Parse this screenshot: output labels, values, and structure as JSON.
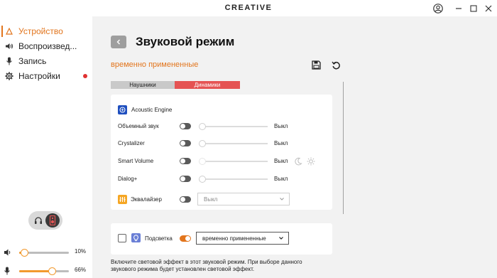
{
  "titlebar": {
    "brand": "CREATIVE",
    "icons": [
      "user-icon",
      "minimize-icon",
      "maximize-icon",
      "close-icon"
    ]
  },
  "sidebar": {
    "items": [
      {
        "label": "Устройство",
        "icon": "device-icon",
        "active": true
      },
      {
        "label": "Воспроизвед...",
        "icon": "playback-icon",
        "active": false
      },
      {
        "label": "Запись",
        "icon": "microphone-icon",
        "active": false
      },
      {
        "label": "Настройки",
        "icon": "gear-icon",
        "active": false,
        "badge": true
      }
    ],
    "mode_toggle": {
      "options": [
        "headphones-icon",
        "speaker-icon"
      ],
      "selected": "speaker-icon"
    },
    "volume": {
      "icon": "speaker-volume-icon",
      "label": "10%",
      "level": 0.1
    },
    "mic_volume": {
      "icon": "microphone-icon",
      "label": "66%",
      "level": 0.66
    }
  },
  "main": {
    "back_icon": "chevron-left-icon",
    "title": "Звуковой режим",
    "subtitle": "временно примененные",
    "save_icon": "save-icon",
    "reset_icon": "reset-icon",
    "tabs": [
      {
        "label": "Наушники",
        "active": false
      },
      {
        "label": "Динамики",
        "active": true
      }
    ],
    "acoustic_engine": {
      "label": "Acoustic Engine",
      "rows": [
        {
          "label": "Объемный звук",
          "value": "Выкл",
          "enabled": false
        },
        {
          "label": "Crystalizer",
          "value": "Выкл",
          "enabled": false
        },
        {
          "label": "Smart Volume",
          "value": "Выкл",
          "enabled": false
        },
        {
          "label": "Dialog+",
          "value": "Выкл",
          "enabled": false
        }
      ],
      "equalizer": {
        "label": "Эквалайзер",
        "value": "Выкл",
        "enabled": false
      }
    },
    "lighting": {
      "label": "Подсветка",
      "enabled": true,
      "checked": false,
      "selected": "временно примененные"
    },
    "footnote": "Включите световой эффект в этот звуковой режим. При выборе данного звукового режима будет установлен световой эффект."
  },
  "colors": {
    "accent": "#e2751d",
    "tab_active": "#e55353",
    "slider_fill": "#f29a2e",
    "acoustic_logo": "#1f4fbf",
    "eq_logo": "#f5a623",
    "bulb_logo": "#6a7fd6",
    "badge": "#e03131"
  }
}
